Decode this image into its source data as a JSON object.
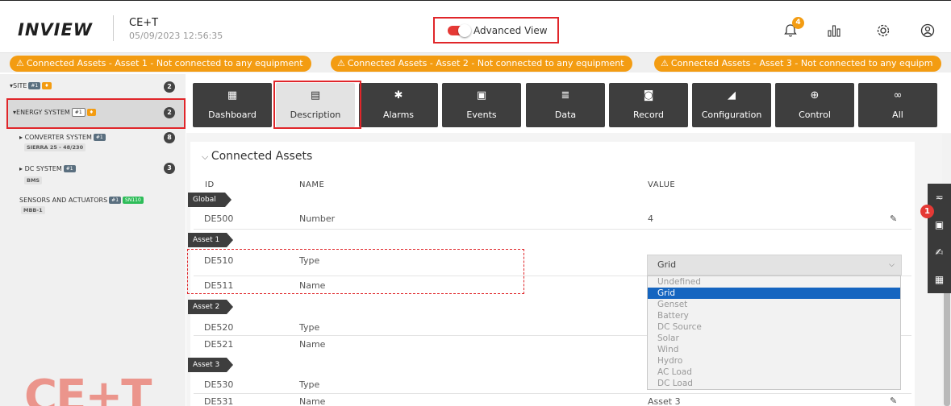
{
  "header": {
    "logo": "INVIEW",
    "device_name": "CE+T",
    "timestamp": "05/09/2023 12:56:35",
    "advanced_view_label": "Advanced View",
    "advanced_view_on": true,
    "notifications_count": "4",
    "icons": [
      "bell-icon",
      "chart-bars-icon",
      "gear-icon",
      "user-icon"
    ]
  },
  "alerts": [
    "Connected Assets - Asset 1 - Not connected to any equipment",
    "Connected Assets - Asset 2 - Not connected to any equipment",
    "Connected Assets - Asset 3 - Not connected to any equipm"
  ],
  "sidebar": {
    "site": {
      "label": "SITE",
      "badge": "#1",
      "count": "2"
    },
    "energy_system": {
      "label": "ENERGY SYSTEM",
      "badge": "#1",
      "count": "2"
    },
    "converter_system": {
      "label": "CONVERTER SYSTEM",
      "badge": "#1",
      "sub": "SIERRA 25 - 48/230",
      "count": "8"
    },
    "dc_system": {
      "label": "DC SYSTEM",
      "badge": "#1",
      "sub": "BMS",
      "count": "3"
    },
    "sensors": {
      "label": "SENSORS AND ACTUATORS",
      "badge": "#1",
      "badge2": "SN110",
      "sub": "MBB-1"
    }
  },
  "tabs": [
    {
      "label": "Dashboard",
      "icon": "dashboard-icon"
    },
    {
      "label": "Description",
      "icon": "document-icon"
    },
    {
      "label": "Alarms",
      "icon": "alarm-icon"
    },
    {
      "label": "Events",
      "icon": "calendar-icon"
    },
    {
      "label": "Data",
      "icon": "data-icon"
    },
    {
      "label": "Record",
      "icon": "record-icon"
    },
    {
      "label": "Configuration",
      "icon": "configuration-icon"
    },
    {
      "label": "Control",
      "icon": "control-icon"
    },
    {
      "label": "All",
      "icon": "infinity-icon"
    }
  ],
  "section": {
    "title": "Connected Assets",
    "columns": {
      "id": "ID",
      "name": "NAME",
      "value": "VALUE"
    },
    "groups": {
      "global": "Global",
      "asset1": "Asset 1",
      "asset2": "Asset 2",
      "asset3": "Asset 3"
    },
    "rows": {
      "de500": {
        "id": "DE500",
        "name": "Number",
        "value": "4"
      },
      "de510": {
        "id": "DE510",
        "name": "Type",
        "value": "Grid"
      },
      "de511": {
        "id": "DE511",
        "name": "Name"
      },
      "de520": {
        "id": "DE520",
        "name": "Type"
      },
      "de521": {
        "id": "DE521",
        "name": "Name"
      },
      "de530": {
        "id": "DE530",
        "name": "Type"
      },
      "de531": {
        "id": "DE531",
        "name": "Name",
        "value": "Asset 3"
      }
    }
  },
  "dropdown": {
    "selected": "Grid",
    "options": [
      "Undefined",
      "Grid",
      "Genset",
      "Battery",
      "DC Source",
      "Solar",
      "Wind",
      "Hydro",
      "AC Load",
      "DC Load"
    ]
  },
  "right_toolbar": {
    "badge": "1",
    "icons": [
      "filter-icon",
      "save-icon",
      "signature-icon",
      "layout-icon"
    ]
  },
  "colors": {
    "accent_red": "#e0262a",
    "alert_orange": "#f39c12",
    "dark_tab": "#3e3e3e",
    "selected_blue": "#1565c0"
  }
}
